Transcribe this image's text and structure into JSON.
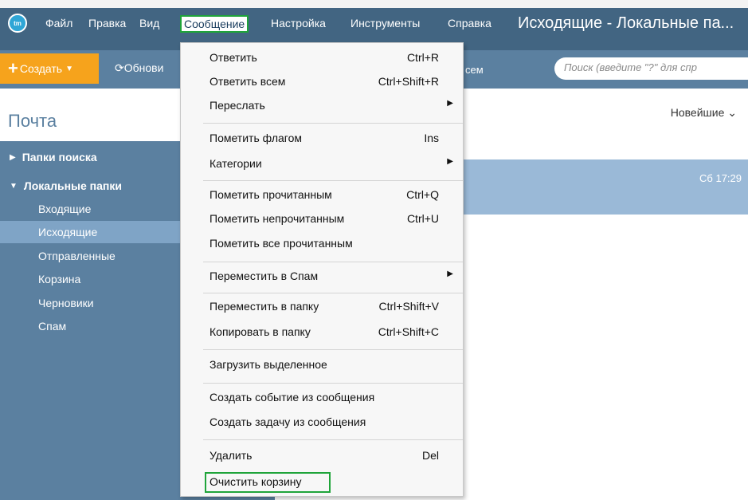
{
  "menubar": {
    "logo": "tm",
    "items": [
      "Файл",
      "Правка",
      "Вид",
      "Сообщение",
      "Настройка",
      "Инструменты",
      "Справка"
    ],
    "active_item": "Сообщение",
    "window_title": "Исходящие - Локальные па..."
  },
  "toolbar": {
    "create_label": "Создать",
    "refresh_label": "Обнови",
    "trail_text": "сем",
    "search_placeholder": "Поиск (введите \"?\" для спр"
  },
  "sidebar": {
    "title": "Почта",
    "groups": [
      {
        "label": "Папки поиска",
        "expanded": false
      },
      {
        "label": "Локальные папки",
        "expanded": true
      }
    ],
    "folders": [
      "Входящие",
      "Исходящие",
      "Отправленные",
      "Корзина",
      "Черновики",
      "Спам"
    ],
    "selected_folder": "Исходящие"
  },
  "list": {
    "sort_label": "Новейшие",
    "message_date": "Сб 17:29"
  },
  "dropdown": {
    "items": [
      {
        "label": "Ответить",
        "shortcut": "Ctrl+R"
      },
      {
        "label": "Ответить всем",
        "shortcut": "Ctrl+Shift+R"
      },
      {
        "label": "Переслать",
        "shortcut": "",
        "submenu": true
      },
      {
        "label": "Пометить флагом",
        "shortcut": "Ins"
      },
      {
        "label": "Категории",
        "shortcut": "",
        "submenu": true
      },
      {
        "label": "Пометить прочитанным",
        "shortcut": "Ctrl+Q"
      },
      {
        "label": "Пометить непрочитанным",
        "shortcut": "Ctrl+U"
      },
      {
        "label": "Пометить все прочитанным",
        "shortcut": ""
      },
      {
        "label": "Переместить в Спам",
        "shortcut": "",
        "submenu": true
      },
      {
        "label": "Переместить в папку",
        "shortcut": "Ctrl+Shift+V"
      },
      {
        "label": "Копировать в папку",
        "shortcut": "Ctrl+Shift+C"
      },
      {
        "label": "Загрузить выделенное",
        "shortcut": ""
      },
      {
        "label": "Создать событие из сообщения",
        "shortcut": ""
      },
      {
        "label": "Создать задачу из сообщения",
        "shortcut": ""
      },
      {
        "label": "Удалить",
        "shortcut": "Del"
      },
      {
        "label": "Очистить корзину",
        "shortcut": ""
      }
    ]
  },
  "colors": {
    "menubar": "#426582",
    "toolbar": "#5b80a0",
    "create_button": "#f6a31c",
    "selection": "#7fa4c6",
    "highlight_border": "#1fa43a"
  }
}
